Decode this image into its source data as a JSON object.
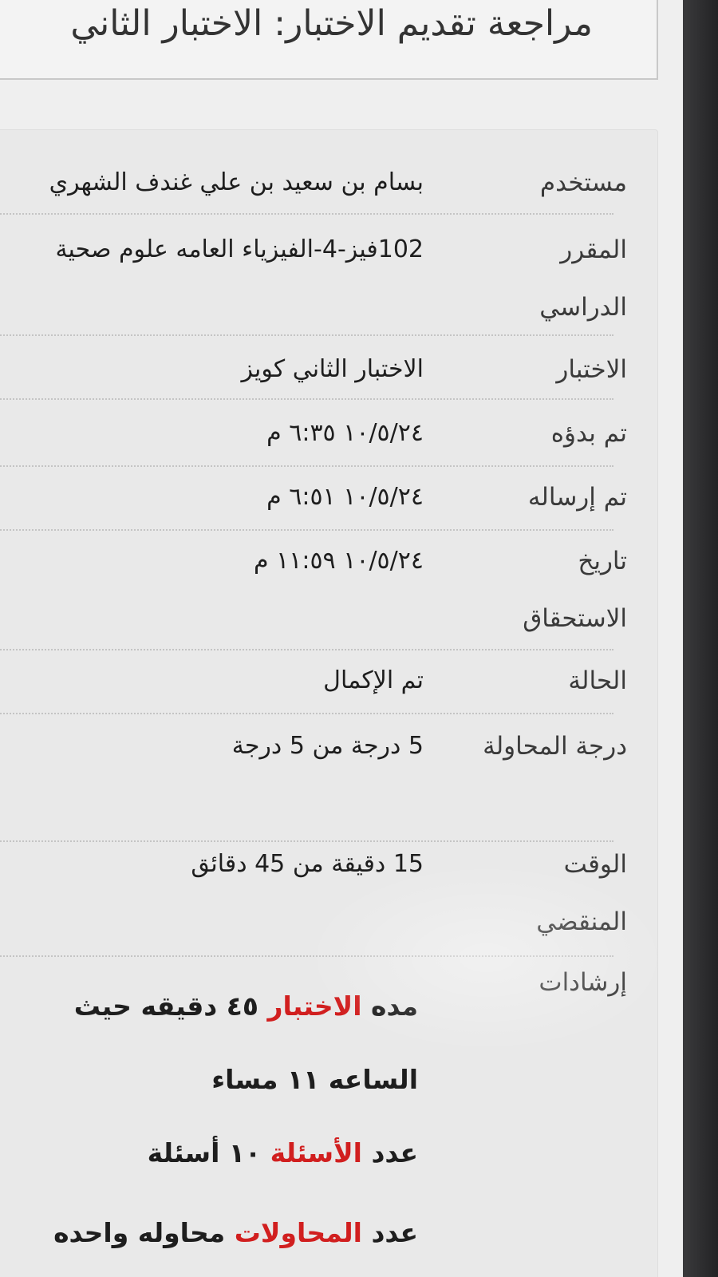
{
  "page_title": "مراجعة تقديم الاختبار: الاختبار الثاني",
  "summary": [
    {
      "label": "مستخدم",
      "value": "بسام بن سعيد بن علي غندف الشهري"
    },
    {
      "label": "المقرر الدراسي",
      "value": "102فيز-4-الفيزياء العامه علوم صحية"
    },
    {
      "label": "الاختبار",
      "value": "الاختبار الثاني كويز"
    },
    {
      "label": "تم بدؤه",
      "value": "١٠/٥/٢٤ ٦:٣٥ م"
    },
    {
      "label": "تم إرساله",
      "value": "١٠/٥/٢٤ ٦:٥١ م"
    },
    {
      "label": "تاريخ الاستحقاق",
      "value": "١٠/٥/٢٤ ١١:٥٩ م"
    },
    {
      "label": "الحالة",
      "value": "تم الإكمال"
    },
    {
      "label": "درجة المحاولة",
      "value": "5 درجة من 5 درجة"
    },
    {
      "label": "الوقت المنقضي",
      "value": "15 دقيقة من 45 دقائق"
    },
    {
      "label": "إرشادات",
      "value": ""
    }
  ],
  "instructions": {
    "line1_a": "مده ",
    "line1_b": "الاختبار",
    "line1_c": " ٤٥ دقيقه حيث",
    "line2": "الساعه ١١ مساء",
    "line3_a": "عدد ",
    "line3_b": "الأسئلة",
    "line3_c": " ١٠ أسئلة",
    "line4_a": "عدد ",
    "line4_b": "المحاولات",
    "line4_c": " محاوله واحده"
  },
  "colors": {
    "highlight": "#d11f1f",
    "text": "#1e1e1e",
    "background": "#efefef"
  }
}
